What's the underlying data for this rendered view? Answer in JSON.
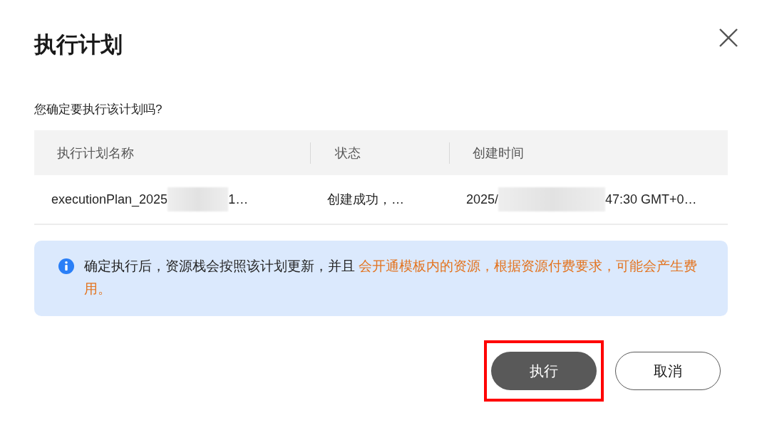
{
  "dialog": {
    "title": "执行计划",
    "question": "您确定要执行该计划吗?"
  },
  "table": {
    "columns": [
      "执行计划名称",
      "状态",
      "创建时间"
    ],
    "rows": [
      {
        "cells": [
          [
            {
              "kind": "text",
              "text": "executionPlan_2025"
            },
            {
              "kind": "redaction"
            },
            {
              "kind": "text",
              "text": "1…"
            }
          ],
          [
            {
              "kind": "text",
              "text": "创建成功，…"
            }
          ],
          [
            {
              "kind": "text",
              "text": "2025/"
            },
            {
              "kind": "redaction"
            },
            {
              "kind": "text",
              "text": "47:30 GMT+0…"
            }
          ]
        ]
      }
    ]
  },
  "notice": {
    "text": "确定执行后，资源栈会按照该计划更新，并且 ",
    "warning": "会开通模板内的资源，根据资源付费要求，可能会产生费用。"
  },
  "buttons": [
    {
      "label": "执行",
      "kind": "primary",
      "highlighted": true
    },
    {
      "label": "取消",
      "kind": "secondary",
      "highlighted": false
    }
  ]
}
